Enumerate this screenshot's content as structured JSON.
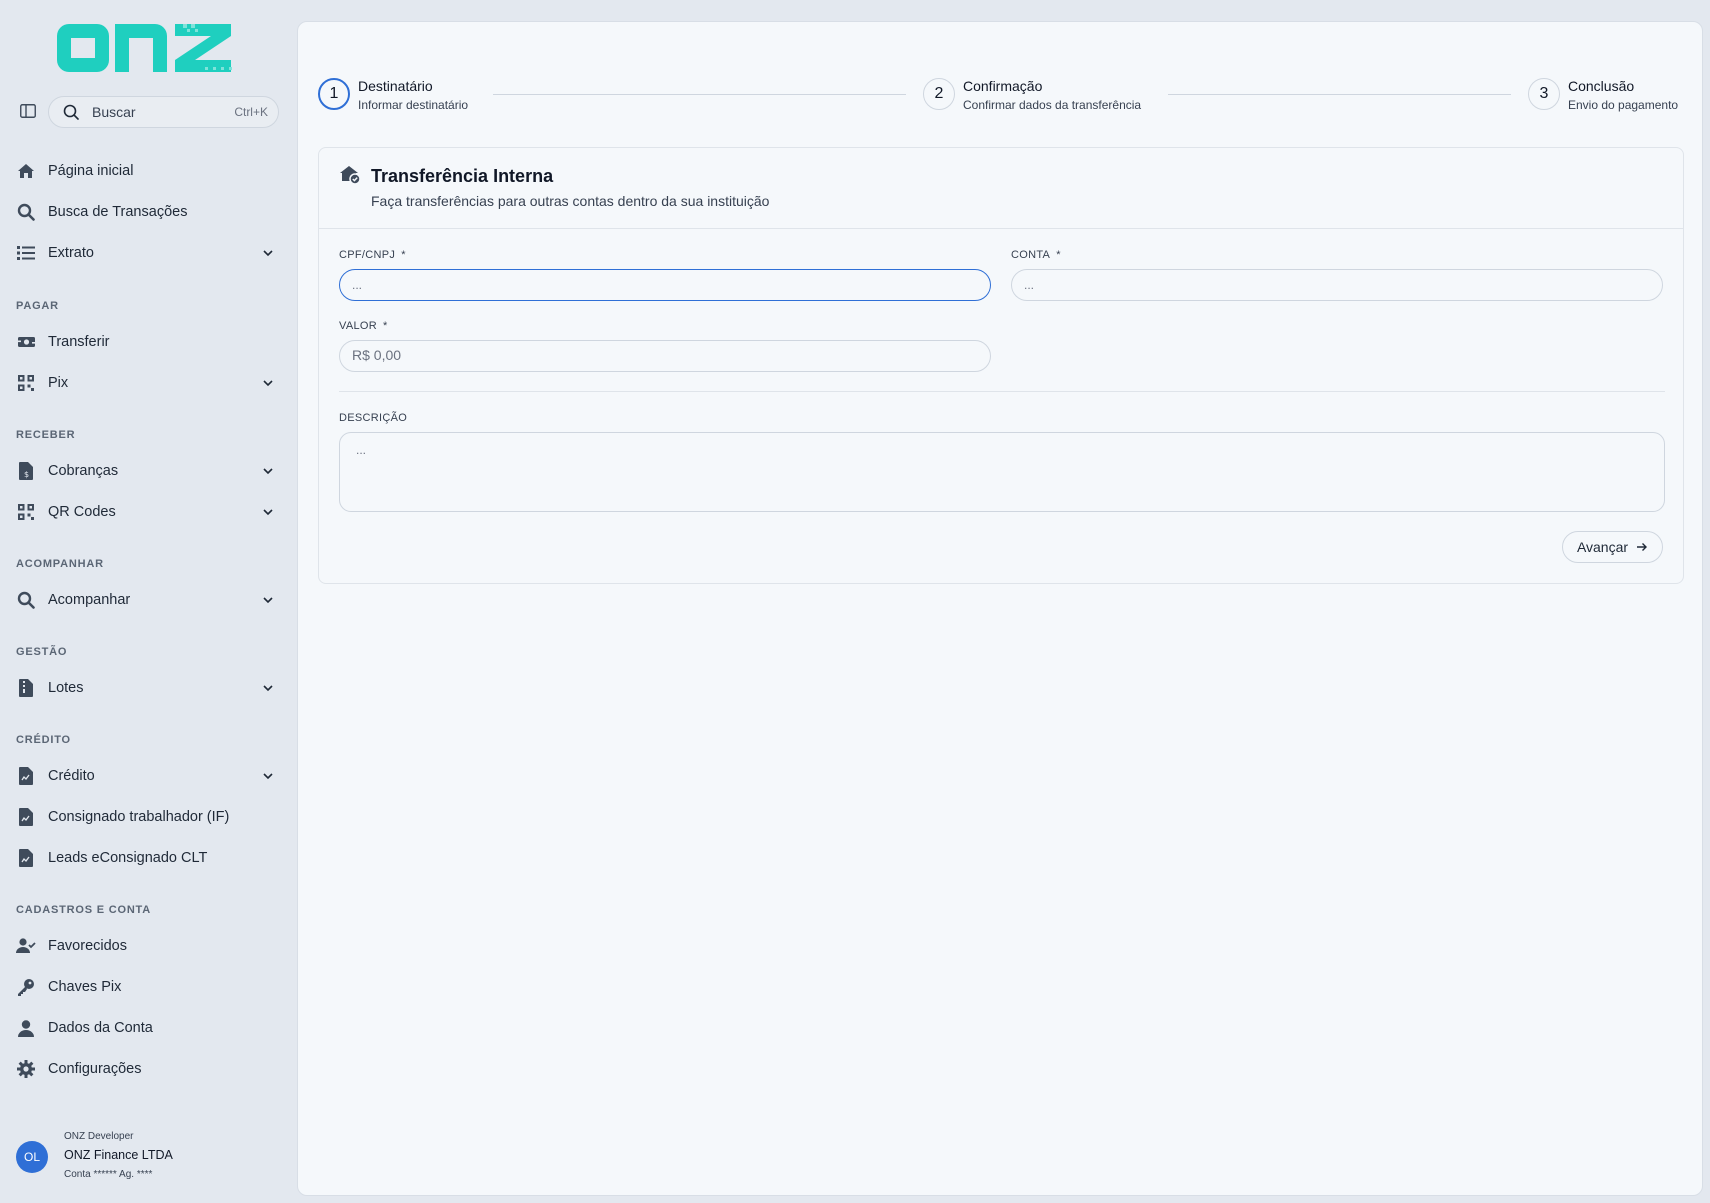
{
  "brand": {
    "logo_text": "onz",
    "logo_color": "#1fcfbf"
  },
  "search": {
    "label": "Buscar",
    "shortcut": "Ctrl+K"
  },
  "nav": {
    "home": "Página inicial",
    "tx_search": "Busca de Transações",
    "statement": "Extrato",
    "sec_pay": "PAGAR",
    "transfer": "Transferir",
    "pix": "Pix",
    "sec_receive": "RECEBER",
    "charges": "Cobranças",
    "qrcodes": "QR Codes",
    "sec_track": "ACOMPANHAR",
    "track": "Acompanhar",
    "sec_mgmt": "GESTÃO",
    "batches": "Lotes",
    "sec_credit": "CRÉDITO",
    "credit": "Crédito",
    "payroll": "Consignado trabalhador (IF)",
    "leads": "Leads eConsignado CLT",
    "sec_account": "CADASTROS E CONTA",
    "payees": "Favorecidos",
    "pix_keys": "Chaves Pix",
    "account_data": "Dados da Conta",
    "settings": "Configurações"
  },
  "user": {
    "initials": "OL",
    "role": "ONZ Developer",
    "company": "ONZ Finance LTDA",
    "account": "Conta ****** Ag. ****"
  },
  "stepper": [
    {
      "number": "1",
      "title": "Destinatário",
      "subtitle": "Informar destinatário"
    },
    {
      "number": "2",
      "title": "Confirmação",
      "subtitle": "Confirmar dados da transferência"
    },
    {
      "number": "3",
      "title": "Conclusão",
      "subtitle": "Envio do pagamento"
    }
  ],
  "form": {
    "title": "Transferência Interna",
    "subtitle": "Faça transferências para outras contas dentro da sua instituição",
    "cpf_label": "CPF/CNPJ",
    "cpf_placeholder": "...",
    "account_label": "CONTA",
    "account_placeholder": "...",
    "value_label": "VALOR",
    "value_placeholder": "R$ 0,00",
    "desc_label": "DESCRIÇÃO",
    "desc_placeholder": "...",
    "required_mark": "*",
    "next_button": "Avançar"
  },
  "colors": {
    "accent": "#2f6fd6",
    "icon": "#3f4b5b",
    "brand": "#1fcfbf"
  }
}
